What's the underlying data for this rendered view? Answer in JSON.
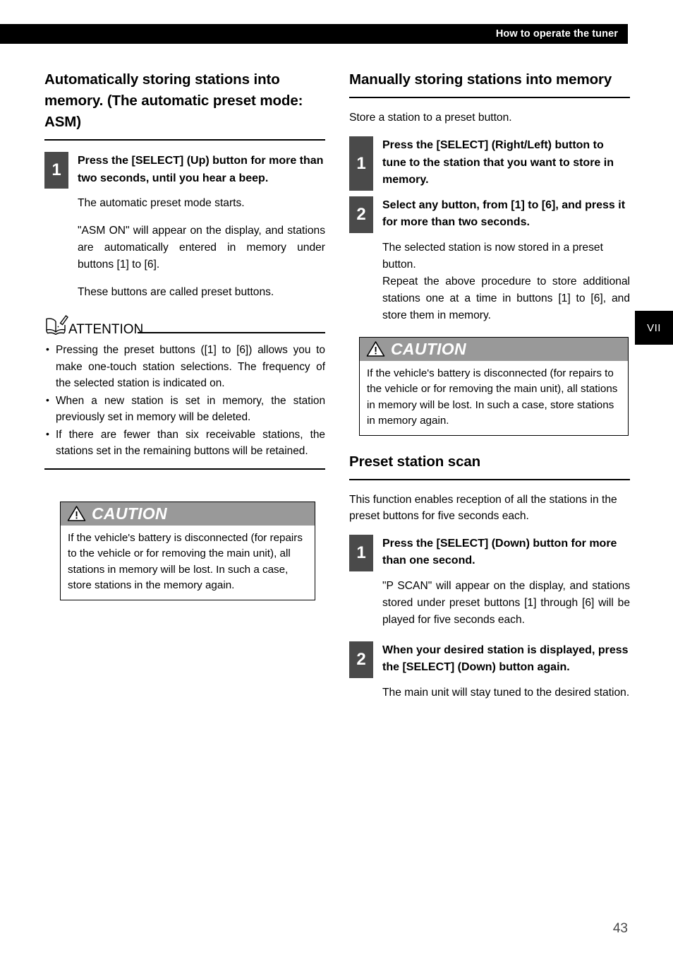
{
  "header": {
    "title": "How to operate the tuner"
  },
  "side_tab": {
    "label": "VII"
  },
  "page_number": "43",
  "colors": {
    "header_bar": "#000000",
    "step_badge": "#4a4a4a",
    "caution_header": "#999999",
    "page_number": "#4a4a4a"
  },
  "left_column": {
    "heading": "Automatically storing stations into memory. (The automatic preset mode: ASM)",
    "steps": [
      {
        "number": "1",
        "title": "Press the [SELECT] (Up) button for more than two seconds, until you hear a beep.",
        "paragraphs": [
          "The automatic preset mode starts.",
          "\"ASM ON\" will appear on the display, and stations are automatically entered in memory under buttons [1] to [6].",
          "These buttons are called preset buttons."
        ]
      }
    ],
    "attention": {
      "label": "ATTENTION",
      "icon": "book-pencil-icon",
      "items": [
        "Pressing the preset buttons ([1] to [6]) allows you to make one-touch station selections. The frequency of the selected station is indicated on.",
        "When a new station is set in memory, the station previously set in memory will be deleted.",
        "If there are fewer than six receivable stations, the stations set in the remaining buttons will be retained."
      ]
    },
    "caution": {
      "title": "CAUTION",
      "icon": "warning-triangle-icon",
      "text": "If the vehicle's battery is disconnected (for repairs to the vehicle or for removing the main unit), all stations in memory will be lost. In such a case, store stations in the memory again."
    }
  },
  "right_column": {
    "section1": {
      "heading": "Manually storing stations into memory",
      "intro": "Store a station to a preset button.",
      "steps": [
        {
          "number": "1",
          "title": "Press the [SELECT] (Right/Left) button to tune to the station that you want to store in memory.",
          "paragraphs": []
        },
        {
          "number": "2",
          "title": "Select any button, from [1] to [6], and press it for more than two seconds.",
          "paragraphs": [
            "The selected station is now stored in a preset button.",
            "Repeat the above procedure to store additional stations one at a time in buttons [1] to [6], and store them in memory."
          ]
        }
      ],
      "caution": {
        "title": "CAUTION",
        "icon": "warning-triangle-icon",
        "text": "If the vehicle's battery is disconnected (for repairs to the vehicle or for removing the main unit), all stations in memory will be lost. In such a case, store stations in memory again."
      }
    },
    "section2": {
      "heading": "Preset station scan",
      "intro": "This function enables reception of all the stations in the preset buttons for five seconds each.",
      "steps": [
        {
          "number": "1",
          "title": "Press the [SELECT] (Down) button for more than one second.",
          "paragraphs": [
            "\"P SCAN\" will appear on the display, and stations stored under preset buttons [1] through [6] will be played for five seconds each."
          ]
        },
        {
          "number": "2",
          "title": "When your desired station is displayed, press the [SELECT] (Down) button again.",
          "paragraphs": [
            "The main unit will stay tuned to the desired station."
          ]
        }
      ]
    }
  }
}
